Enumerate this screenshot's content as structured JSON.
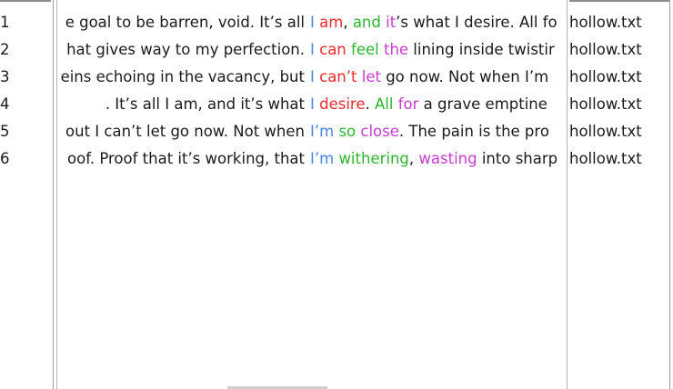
{
  "colors": {
    "red": "#ee2a2a",
    "green": "#2fb52f",
    "blue": "#4a86e8",
    "purple": "#c63ccf",
    "text": "#1a1a1a"
  },
  "rows": [
    {
      "num": "1",
      "left": "e goal to be  barren, void. It’s all",
      "right": [
        {
          "t": "I",
          "c": "blue"
        },
        {
          "t": " "
        },
        {
          "t": "am",
          "c": "red"
        },
        {
          "t": ", "
        },
        {
          "t": "and",
          "c": "green"
        },
        {
          "t": " "
        },
        {
          "t": "it",
          "c": "purple"
        },
        {
          "t": "’s what I desire.  All fo"
        }
      ],
      "file": "hollow.txt"
    },
    {
      "num": "2",
      "left": "hat gives way to my perfection.",
      "right": [
        {
          "t": "I",
          "c": "blue"
        },
        {
          "t": " "
        },
        {
          "t": "can",
          "c": "red"
        },
        {
          "t": " "
        },
        {
          "t": "feel",
          "c": "green"
        },
        {
          "t": " "
        },
        {
          "t": "the",
          "c": "purple"
        },
        {
          "t": " lining inside twistir"
        }
      ],
      "file": "hollow.txt"
    },
    {
      "num": "3",
      "left": "eins echoing in the vacancy, but",
      "right": [
        {
          "t": "I",
          "c": "blue"
        },
        {
          "t": " "
        },
        {
          "t": "can’t",
          "c": "red"
        },
        {
          "t": " "
        },
        {
          "t": "let",
          "c": "purple"
        },
        {
          "t": " go now. Not when I’m"
        }
      ],
      "file": "hollow.txt"
    },
    {
      "num": "4",
      "left": ". It’s all I am, and it’s what",
      "right": [
        {
          "t": "I",
          "c": "blue"
        },
        {
          "t": " "
        },
        {
          "t": "desire",
          "c": "red"
        },
        {
          "t": ".  "
        },
        {
          "t": "All",
          "c": "green"
        },
        {
          "t": " "
        },
        {
          "t": "for",
          "c": "purple"
        },
        {
          "t": " a grave emptine"
        }
      ],
      "file": "hollow.txt"
    },
    {
      "num": "5",
      "left": "out I can’t let go now. Not when",
      "right": [
        {
          "t": "I’m",
          "c": "blue"
        },
        {
          "t": " "
        },
        {
          "t": "so",
          "c": "green"
        },
        {
          "t": " "
        },
        {
          "t": "close",
          "c": "purple"
        },
        {
          "t": ".  The pain is the pro"
        }
      ],
      "file": "hollow.txt"
    },
    {
      "num": "6",
      "left": "oof. Proof that it’s working, that",
      "right": [
        {
          "t": "I’m",
          "c": "blue"
        },
        {
          "t": " "
        },
        {
          "t": "withering",
          "c": "green"
        },
        {
          "t": ", "
        },
        {
          "t": "wasting",
          "c": "purple"
        },
        {
          "t": " into sharp"
        }
      ],
      "file": "hollow.txt"
    }
  ]
}
